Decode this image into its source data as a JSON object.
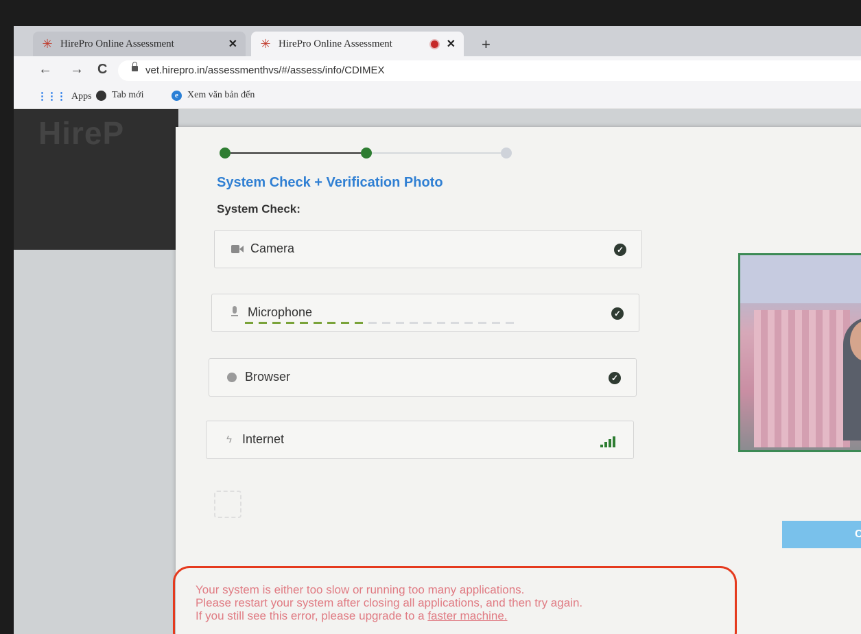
{
  "tabs": [
    {
      "title": "HirePro Online Assessment",
      "favicon": "hirepro-icon",
      "active": false
    },
    {
      "title": "HirePro Online Assessment",
      "favicon": "hirepro-icon",
      "active": true,
      "recording": true
    }
  ],
  "browser": {
    "url": "vet.hirepro.in/assessmenthvs/#/assess/info/CDIMEX",
    "bookmarks": [
      {
        "label": "Apps",
        "icon": "apps-grid-icon"
      },
      {
        "label": "Tab mới",
        "icon": "globe-icon"
      },
      {
        "label": "Xem văn bản đến",
        "icon": "edge-icon"
      }
    ]
  },
  "page": {
    "logo": "HireP",
    "stepper": {
      "total": 3,
      "completed": 2
    },
    "section_title": "System Check + Verification Photo",
    "sub_title": "System Check:",
    "checks": [
      {
        "label": "Camera",
        "status": "ok",
        "icon": "camera-icon"
      },
      {
        "label": "Microphone",
        "status": "ok",
        "icon": "microphone-icon",
        "level": 0.45
      },
      {
        "label": "Browser",
        "status": "ok",
        "icon": "globe-icon"
      },
      {
        "label": "Internet",
        "status": "signal",
        "icon": "bolt-icon"
      }
    ],
    "capture_button_label": "Clic",
    "error": {
      "line1": "Your system is either too slow or running too many applications.",
      "line2": "Please restart your system after closing all applications, and then try again.",
      "line3_prefix": "If you still see this error, please upgrade to a ",
      "line3_link": "faster machine."
    }
  },
  "colors": {
    "accent": "#2f7fd3",
    "success": "#2e7d32",
    "error_text": "#e07b83",
    "highlight": "#e53a1e"
  }
}
